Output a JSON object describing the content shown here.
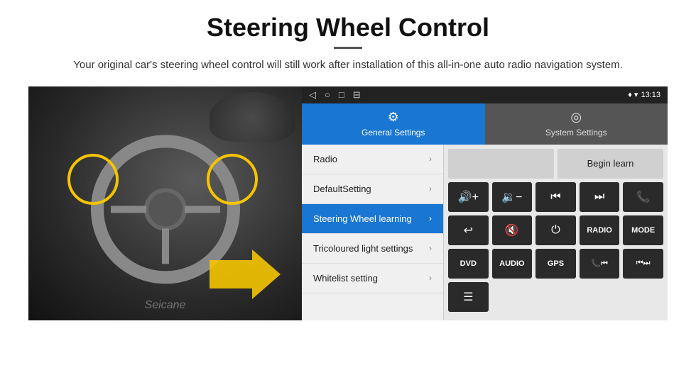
{
  "header": {
    "title": "Steering Wheel Control",
    "subtitle": "Your original car's steering wheel control will still work after installation of this all-in-one auto radio navigation system."
  },
  "status_bar": {
    "nav_icons": [
      "◁",
      "○",
      "□",
      "⊟"
    ],
    "right": {
      "signal": "♦ ▾",
      "time": "13:13"
    }
  },
  "tabs": [
    {
      "label": "General Settings",
      "icon": "⚙",
      "active": true
    },
    {
      "label": "System Settings",
      "icon": "◎",
      "active": false
    }
  ],
  "menu": [
    {
      "label": "Radio",
      "active": false
    },
    {
      "label": "DefaultSetting",
      "active": false
    },
    {
      "label": "Steering Wheel learning",
      "active": true
    },
    {
      "label": "Tricoloured light settings",
      "active": false
    },
    {
      "label": "Whitelist setting",
      "active": false
    }
  ],
  "panel": {
    "begin_learn_label": "Begin learn",
    "buttons_row1": [
      {
        "icon": "◀+",
        "label": "vol up"
      },
      {
        "icon": "◀−",
        "label": "vol down"
      },
      {
        "icon": "⏮",
        "label": "prev"
      },
      {
        "icon": "⏭",
        "label": "next"
      },
      {
        "icon": "✆",
        "label": "call"
      }
    ],
    "buttons_row2": [
      {
        "icon": "↩",
        "label": "back"
      },
      {
        "icon": "🔇",
        "label": "mute"
      },
      {
        "icon": "⏻",
        "label": "power"
      },
      {
        "icon": "RADIO",
        "label": "radio",
        "text": true
      },
      {
        "icon": "MODE",
        "label": "mode",
        "text": true
      }
    ],
    "buttons_row3": [
      {
        "icon": "DVD",
        "label": "dvd",
        "text": true
      },
      {
        "icon": "AUDIO",
        "label": "audio",
        "text": true
      },
      {
        "icon": "GPS",
        "label": "gps",
        "text": true
      },
      {
        "icon": "✆⏮",
        "label": "call-prev"
      },
      {
        "icon": "⏮⏭",
        "label": "prev-next"
      }
    ],
    "buttons_row4": [
      {
        "icon": "☰",
        "label": "menu"
      }
    ]
  },
  "watermark": "Seicane"
}
